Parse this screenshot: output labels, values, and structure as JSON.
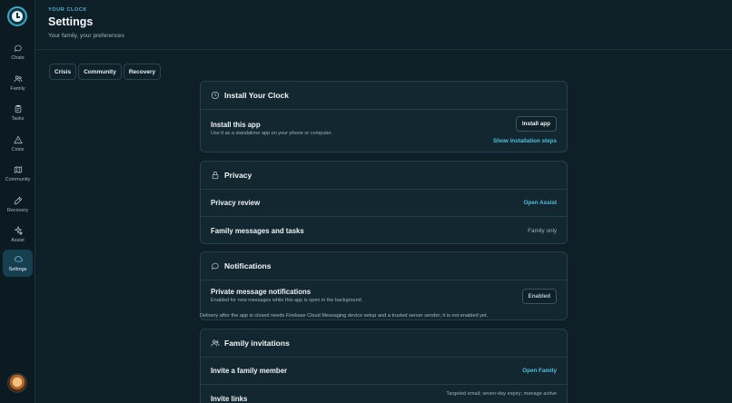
{
  "sidebar": {
    "items": [
      {
        "label": "Chats",
        "icon": "chat-icon"
      },
      {
        "label": "Family",
        "icon": "family-icon"
      },
      {
        "label": "Tasks",
        "icon": "clipboard-icon"
      },
      {
        "label": "Crisis",
        "icon": "warning-icon"
      },
      {
        "label": "Community",
        "icon": "map-icon"
      },
      {
        "label": "Recovery",
        "icon": "pencil-icon"
      },
      {
        "label": "Assist",
        "icon": "sparkle-icon"
      },
      {
        "label": "Settings",
        "icon": "settings-icon"
      }
    ],
    "active": "Settings"
  },
  "header": {
    "eyebrow": "YOUR CLOCK",
    "title": "Settings",
    "subtitle": "Your family, your preferences"
  },
  "tabs": [
    "Crisis",
    "Community",
    "Recovery"
  ],
  "install": {
    "title": "Install Your Clock",
    "row_title": "Install this app",
    "row_desc": "Use it as a standalone app on your phone or computer.",
    "button": "Install app",
    "steps_link": "Show installation steps"
  },
  "privacy": {
    "title": "Privacy",
    "review_title": "Privacy review",
    "review_action": "Open Assist",
    "messages_title": "Family messages and tasks",
    "messages_value": "Family only"
  },
  "notifications": {
    "title": "Notifications",
    "row_title": "Private message notifications",
    "row_desc": "Enabled for new messages while this app is open in the background.",
    "status": "Enabled",
    "note": "Delivery after the app is closed needs Firebase Cloud Messaging device setup and a trusted server sender; it is not enabled yet."
  },
  "invitations": {
    "title": "Family invitations",
    "invite_title": "Invite a family member",
    "invite_action": "Open Family",
    "links_title": "Invite links",
    "links_desc": "Targeted email; seven-day expiry; manage active"
  },
  "colors": {
    "accent": "#4fc0de",
    "background": "#0f1f27",
    "card": "#132731"
  }
}
